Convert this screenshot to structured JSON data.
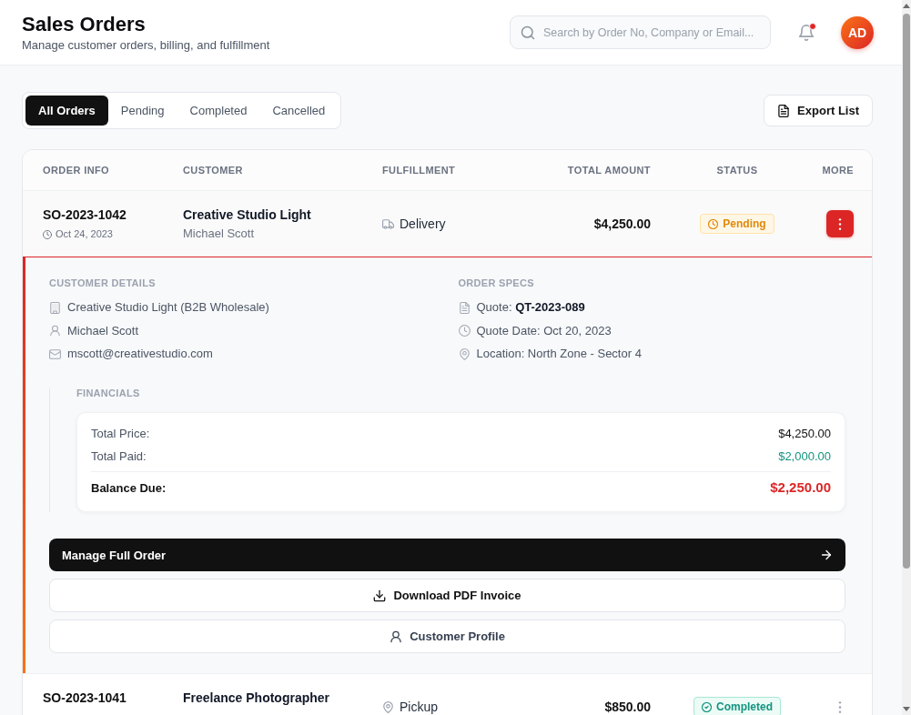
{
  "header": {
    "title": "Sales Orders",
    "subtitle": "Manage customer orders, billing, and fulfillment",
    "search": {
      "placeholder": "Search by Order No, Company or Email..."
    },
    "notifications": {
      "unread": true
    },
    "avatar": {
      "initials": "AD"
    }
  },
  "tabs": [
    {
      "label": "All Orders",
      "selected": true
    },
    {
      "label": "Pending",
      "selected": false
    },
    {
      "label": "Completed",
      "selected": false
    },
    {
      "label": "Cancelled",
      "selected": false
    }
  ],
  "export_button": {
    "label": "Export List"
  },
  "table": {
    "columns": [
      "ORDER INFO",
      "CUSTOMER",
      "FULFILLMENT",
      "TOTAL AMOUNT",
      "STATUS",
      "MORE"
    ],
    "rows": [
      {
        "order_no": "SO-2023-1042",
        "date": "Oct 24, 2023",
        "customer": "Creative Studio Light",
        "contact": "Michael Scott",
        "fulfillment": {
          "kind": "delivery",
          "label": "Delivery"
        },
        "total": "$4,250.00",
        "status": {
          "kind": "pending",
          "label": "Pending"
        },
        "expanded": true,
        "details": {
          "sections": [
            {
              "title": "CUSTOMER DETAILS",
              "items": [
                {
                  "kind": "company",
                  "text": "Creative Studio Light (B2B Wholesale)"
                },
                {
                  "kind": "person",
                  "text": "Michael Scott"
                },
                {
                  "kind": "email",
                  "text": "mscott@creativestudio.com"
                }
              ]
            },
            {
              "title": "ORDER SPECS",
              "items": [
                {
                  "kind": "quote",
                  "text": "Quote: **QT-2023-089**"
                },
                {
                  "kind": "date",
                  "text": "Quote Date: Oct 20, 2023"
                },
                {
                  "kind": "location",
                  "text": "Location: North Zone - Sector 4"
                }
              ]
            }
          ],
          "financials": {
            "title": "FINANCIALS",
            "lines": [
              {
                "kind": "price",
                "label": "Total Price:",
                "value": "$4,250.00"
              },
              {
                "kind": "paid",
                "label": "Total Paid:",
                "value": "$2,000.00"
              },
              {
                "kind": "balance",
                "label": "Balance Due:",
                "value": "$2,250.00"
              }
            ]
          },
          "actions": [
            {
              "kind": "primary",
              "label": "Manage Full Order"
            },
            {
              "kind": "download",
              "label": "Download PDF Invoice"
            },
            {
              "kind": "profile",
              "label": "Customer Profile"
            }
          ]
        }
      },
      {
        "order_no": "SO-2023-1041",
        "customer": "Freelance Photographer",
        "fulfillment": {
          "kind": "pickup",
          "label": "Pickup"
        },
        "total": "$850.00",
        "status": {
          "kind": "completed",
          "label": "Completed"
        },
        "expanded": false
      }
    ]
  }
}
